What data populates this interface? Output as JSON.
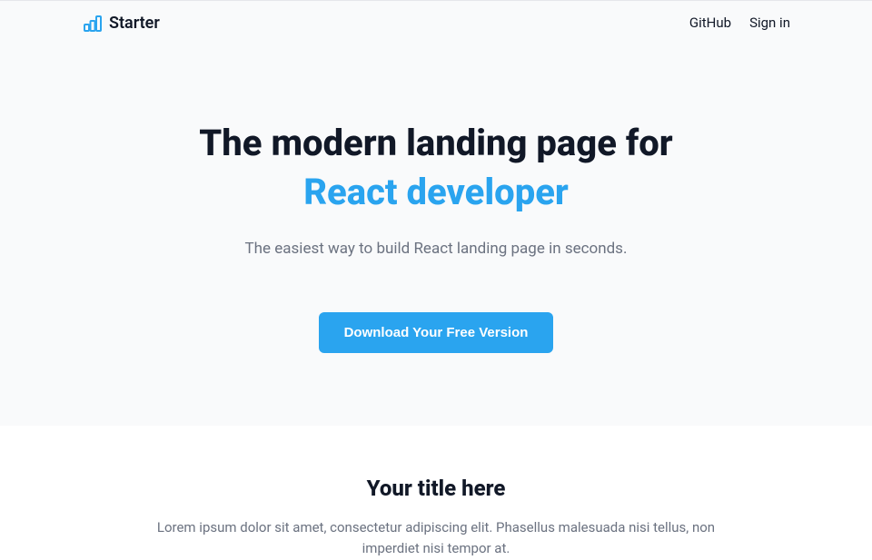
{
  "brand": {
    "name": "Starter"
  },
  "nav": {
    "links": [
      {
        "label": "GitHub"
      },
      {
        "label": "Sign in"
      }
    ]
  },
  "hero": {
    "title_line1": "The modern landing page for",
    "title_line2": "React developer",
    "subtitle": "The easiest way to build React landing page in seconds.",
    "cta_label": "Download Your Free Version"
  },
  "feature": {
    "title": "Your title here",
    "description": "Lorem ipsum dolor sit amet, consectetur adipiscing elit. Phasellus malesuada nisi tellus, non imperdiet nisi tempor at."
  },
  "colors": {
    "accent": "#2aa4ef",
    "bg_light": "#f9fafb",
    "text_muted": "#6b7280"
  }
}
